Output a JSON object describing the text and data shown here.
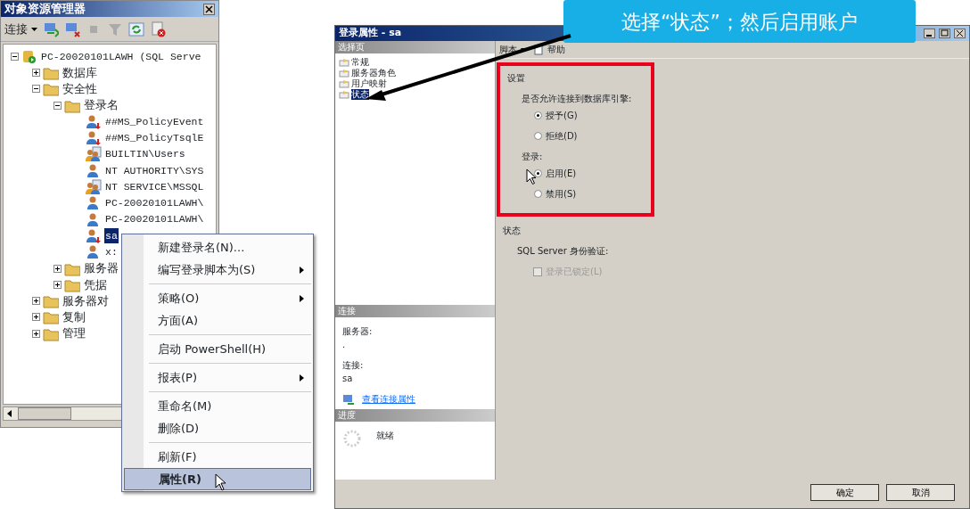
{
  "explorer": {
    "title": "对象资源管理器",
    "connect": "连接",
    "tree": [
      {
        "label": "PC-20020101LAWH (SQL Serve",
        "kind": "server",
        "expanded": true,
        "selected": false,
        "children": [
          {
            "label": "数据库",
            "kind": "folder",
            "expanded": false,
            "selected": false
          },
          {
            "label": "安全性",
            "kind": "folder",
            "expanded": true,
            "selected": false,
            "children": [
              {
                "label": "登录名",
                "kind": "folder",
                "expanded": true,
                "selected": false,
                "children": [
                  {
                    "label": "##MS_PolicyEvent",
                    "kind": "user-denied",
                    "selected": false
                  },
                  {
                    "label": "##MS_PolicyTsqlE",
                    "kind": "user-denied",
                    "selected": false
                  },
                  {
                    "label": "BUILTIN\\Users",
                    "kind": "group",
                    "selected": false
                  },
                  {
                    "label": "NT AUTHORITY\\SYS",
                    "kind": "user",
                    "selected": false
                  },
                  {
                    "label": "NT SERVICE\\MSSQL",
                    "kind": "group",
                    "selected": false
                  },
                  {
                    "label": "PC-20020101LAWH\\",
                    "kind": "user",
                    "selected": false
                  },
                  {
                    "label": "PC-20020101LAWH\\",
                    "kind": "user",
                    "selected": false
                  },
                  {
                    "label": "sa",
                    "kind": "user-denied",
                    "selected": true
                  },
                  {
                    "label": "x:",
                    "kind": "user",
                    "selected": false
                  }
                ]
              },
              {
                "label": "服务器",
                "kind": "folder",
                "expanded": false,
                "selected": false
              },
              {
                "label": "凭据",
                "kind": "folder",
                "expanded": false,
                "selected": false
              }
            ]
          },
          {
            "label": "服务器对",
            "kind": "folder",
            "expanded": false,
            "selected": false
          },
          {
            "label": "复制",
            "kind": "folder",
            "expanded": false,
            "selected": false
          },
          {
            "label": "管理",
            "kind": "folder",
            "expanded": false,
            "selected": false
          }
        ]
      }
    ]
  },
  "context_menu": [
    [
      {
        "label": "新建登录名(N)...",
        "submenu": false,
        "selected": false
      },
      {
        "label": "编写登录脚本为(S)",
        "submenu": true,
        "selected": false
      }
    ],
    [
      {
        "label": "策略(O)",
        "submenu": true,
        "selected": false
      },
      {
        "label": "方面(A)",
        "submenu": false,
        "selected": false
      }
    ],
    [
      {
        "label": "启动 PowerShell(H)",
        "submenu": false,
        "selected": false
      }
    ],
    [
      {
        "label": "报表(P)",
        "submenu": true,
        "selected": false
      }
    ],
    [
      {
        "label": "重命名(M)",
        "submenu": false,
        "selected": false
      },
      {
        "label": "删除(D)",
        "submenu": false,
        "selected": false
      }
    ],
    [
      {
        "label": "刷新(F)",
        "submenu": false,
        "selected": false
      },
      {
        "label": "属性(R)",
        "submenu": false,
        "selected": true
      }
    ]
  ],
  "dialog": {
    "title": "登录属性 - sa",
    "pages_heading": "选择页",
    "pages": [
      {
        "label": "常规",
        "selected": false
      },
      {
        "label": "服务器角色",
        "selected": false
      },
      {
        "label": "用户映射",
        "selected": false
      },
      {
        "label": "状态",
        "selected": true
      }
    ],
    "toolbar": [
      "脚本",
      "帮助"
    ],
    "connection": {
      "heading": "连接",
      "server_label": "服务器:",
      "server": ".",
      "connection_label": "连接:",
      "connection": "sa",
      "link": "查看连接属性"
    },
    "progress": {
      "heading": "进度",
      "status": "就绪"
    },
    "settings": {
      "heading": "设置",
      "permission_label": "是否允许连接到数据库引擎:",
      "permission_options": [
        {
          "label": "授予(G)",
          "selected": true
        },
        {
          "label": "拒绝(D)",
          "selected": false
        }
      ],
      "login_label": "登录:",
      "login_options": [
        {
          "label": "启用(E)",
          "selected": true
        },
        {
          "label": "禁用(S)",
          "selected": false
        }
      ]
    },
    "status": {
      "heading": "状态",
      "auth_label": "SQL Server 身份验证:",
      "locked": {
        "label": "登录已锁定(L)",
        "checked": false,
        "disabled": true
      }
    },
    "buttons": [
      "确定",
      "取消"
    ]
  },
  "callout": "选择“状态”；然后启用账户"
}
